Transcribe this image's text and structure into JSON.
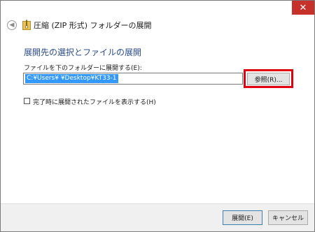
{
  "window": {
    "title": "圧縮 (ZIP 形式) フォルダーの展開",
    "close_glyph": "✕",
    "back_glyph": "◀",
    "icons": [
      "close-icon",
      "back-arrow-icon",
      "zip-folder-icon"
    ]
  },
  "main": {
    "heading": "展開先の選択とファイルの展開",
    "destination_label": "ファイルを下のフォルダーに展開する(E):",
    "destination_value": "C:¥Users¥      ¥Desktop¥KT33-1",
    "browse_label": "参照(R)...",
    "show_files_checkbox": {
      "label": "完了時に展開されたファイルを表示する(H)",
      "checked": false
    }
  },
  "footer": {
    "extract_label": "展開(E)",
    "cancel_label": "キャンセル"
  },
  "colors": {
    "heading": "#2b4c8a",
    "selection": "#3399ff",
    "highlight": "#e00012",
    "close_button": "#c7312c"
  }
}
